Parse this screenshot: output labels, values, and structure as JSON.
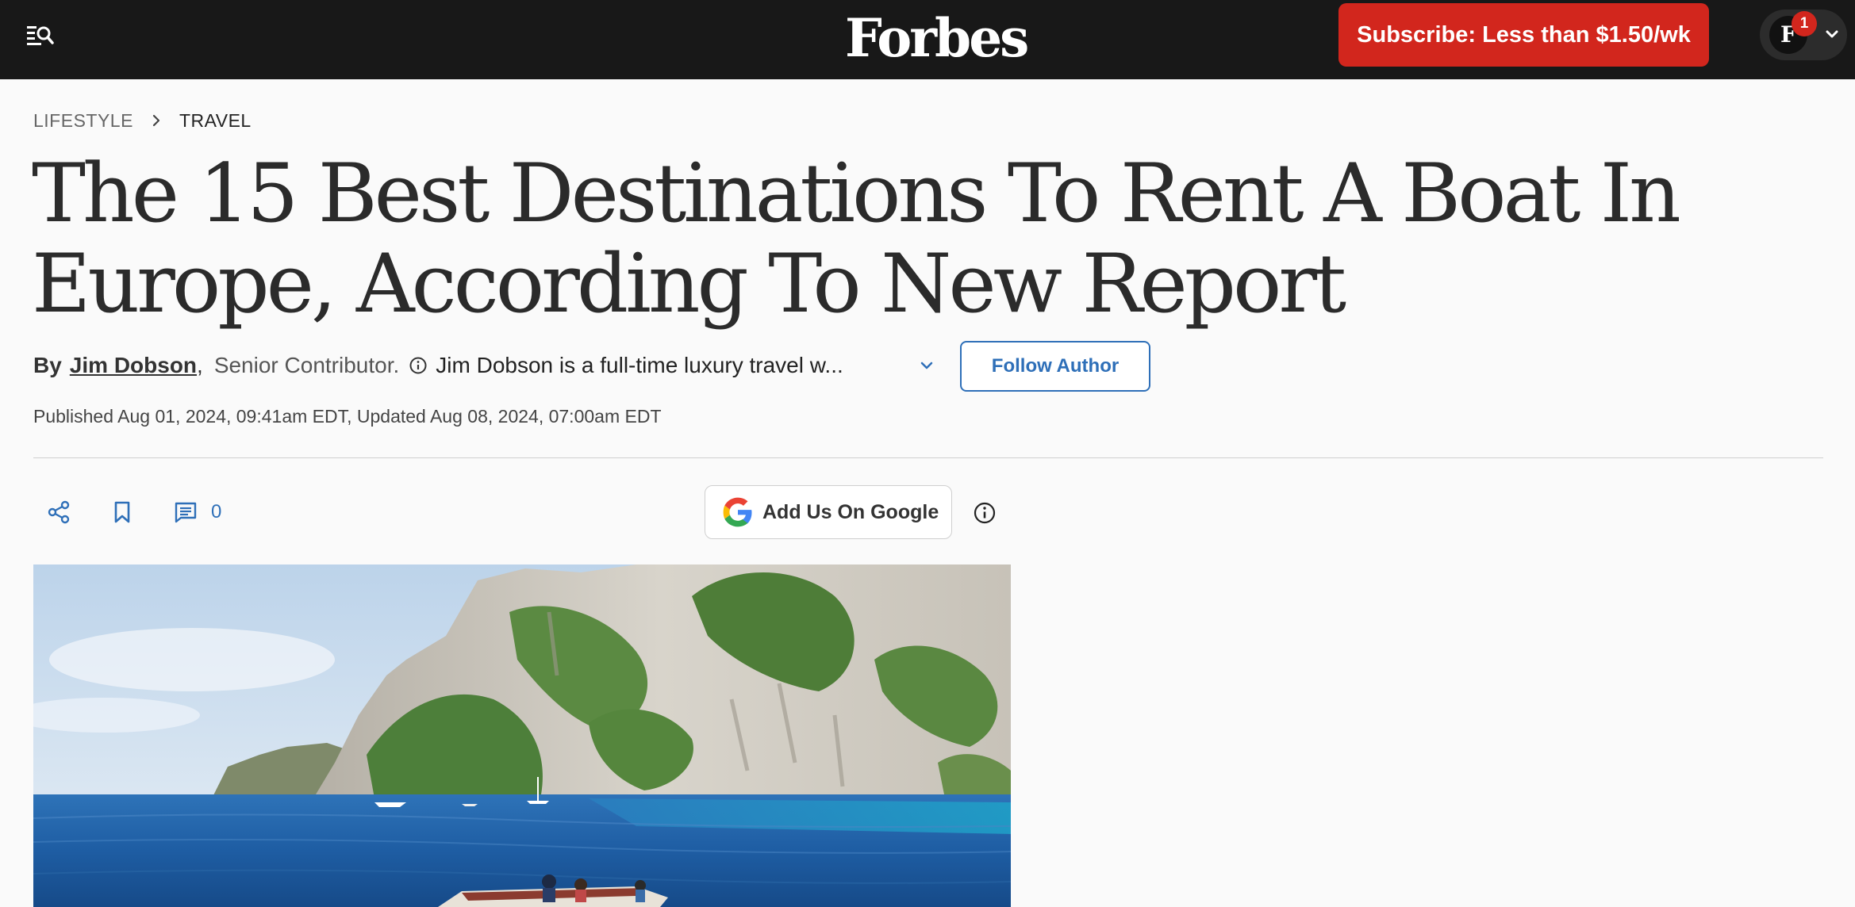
{
  "header": {
    "logo": "Forbes",
    "subscribe_label": "Subscribe: Less than $1.50/wk",
    "avatar_initial": "F",
    "notification_count": "1"
  },
  "breadcrumb": [
    "LIFESTYLE",
    "TRAVEL"
  ],
  "article": {
    "title": "The 15 Best Destinations To Rent A Boat In Europe, According To New Report",
    "by_label": "By",
    "author": "Jim Dobson",
    "comma": ",",
    "role": "Senior Contributor.",
    "bio": "Jim Dobson is a full-time luxury travel w...",
    "follow_label": "Follow Author",
    "dates": "Published Aug 01, 2024, 09:41am EDT, Updated Aug 08, 2024, 07:00am EDT"
  },
  "actions": {
    "comment_count": "0",
    "google_label": "Add Us On Google"
  },
  "colors": {
    "header_bg": "#181818",
    "subscribe_bg": "#d2261d",
    "link_blue": "#2e6fb8"
  },
  "icons": [
    "menu-search-icon",
    "chevron-down-icon",
    "chevron-right-icon",
    "info-icon",
    "share-icon",
    "bookmark-icon",
    "comment-icon",
    "google-icon"
  ]
}
